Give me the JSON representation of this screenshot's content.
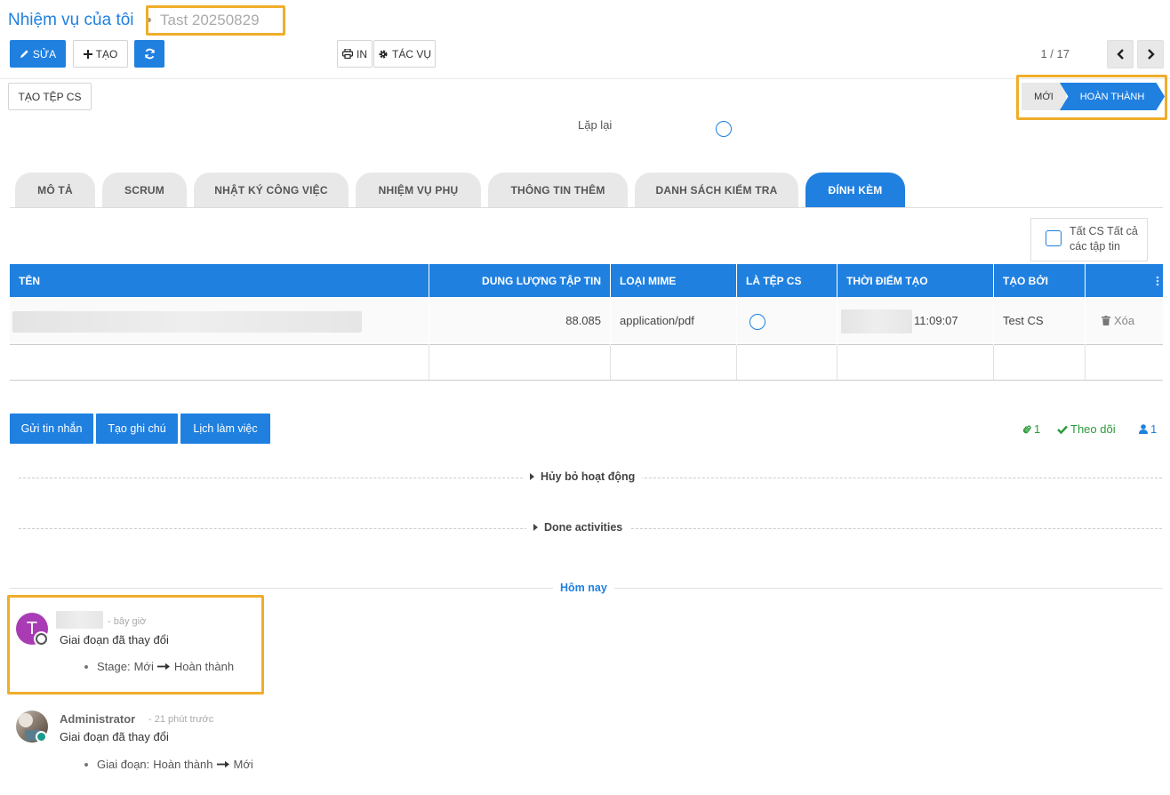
{
  "breadcrumb": {
    "parent": "Nhiệm vụ của tôi",
    "current": "Tast 20250829"
  },
  "toolbar": {
    "edit_label": "SỬA",
    "create_label": "TẠO",
    "print_label": "IN",
    "action_label": "TÁC VỤ",
    "pager": "1 / 17"
  },
  "create_cs_file_label": "TẠO TỆP CS",
  "stages": {
    "new": "MỚI",
    "done": "HOÀN THÀNH",
    "active": "HOÀN THÀNH"
  },
  "repeat_label": "Lặp lại",
  "tabs": [
    {
      "label": "MÔ TẢ"
    },
    {
      "label": "SCRUM"
    },
    {
      "label": "NHẬT KÝ CÔNG VIỆC"
    },
    {
      "label": "NHIỆM VỤ PHỤ"
    },
    {
      "label": "THÔNG TIN THÊM"
    },
    {
      "label": "DANH SÁCH KIỂM TRA"
    },
    {
      "label": "ĐÍNH KÈM"
    }
  ],
  "active_tab": "ĐÍNH KÈM",
  "all_cs_files_label": "Tất CS Tất cả các tập tin",
  "table": {
    "columns": [
      "TÊN",
      "DUNG LƯỢNG TẬP TIN",
      "LOẠI MIME",
      "LÀ TỆP CS",
      "THỜI ĐIỂM TẠO",
      "TẠO BỞI"
    ],
    "rows": [
      {
        "size": "88.085",
        "mime": "application/pdf",
        "time": "11:09:07",
        "created_by": "Test CS",
        "delete_label": "Xóa"
      }
    ]
  },
  "chatter": {
    "send_message": "Gửi tin nhắn",
    "log_note": "Tạo ghi chú",
    "schedule": "Lịch làm việc",
    "attachments_count": "1",
    "follow_label": "Theo dõi",
    "followers_count": "1",
    "cancelled_activities": "Hủy bỏ hoạt động",
    "done_activities": "Done activities",
    "today": "Hôm nay",
    "messages": [
      {
        "avatar_letter": "T",
        "time": "- bây giờ",
        "body": "Giai đoạn đã thay đổi",
        "change_field": "Stage:",
        "change_from": "Mới",
        "change_to": "Hoàn thành"
      },
      {
        "author": "Administrator",
        "time": "- 21 phút trước",
        "body": "Giai đoạn đã thay đổi",
        "change_field": "Giai đoạn:",
        "change_from": "Hoàn thành",
        "change_to": "Mới"
      }
    ]
  },
  "colors": {
    "primary": "#1f80e0",
    "highlight": "#f0ad2b",
    "avatar_purple": "#a93bb4",
    "follow_green": "#2a9a3a"
  }
}
